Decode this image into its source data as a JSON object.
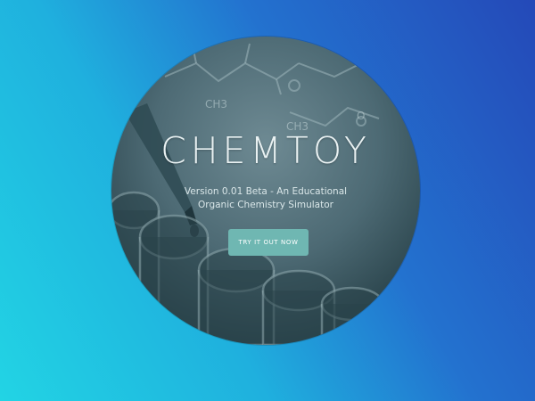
{
  "hero": {
    "title": "CHEMTOY",
    "subtitle": "Version 0.01 Beta - An Educational Organic Chemistry Simulator",
    "cta_label": "TRY IT OUT NOW",
    "background_image": "laboratory glassware with molecular structure overlay",
    "molecule_labels": [
      "CH3",
      "CH3",
      "O"
    ]
  },
  "colors": {
    "background_gradient_start": "#22d4e4",
    "background_gradient_end": "#2449b8",
    "cta_button": "#6fb7b2",
    "title_text": "#e9f1f2"
  }
}
